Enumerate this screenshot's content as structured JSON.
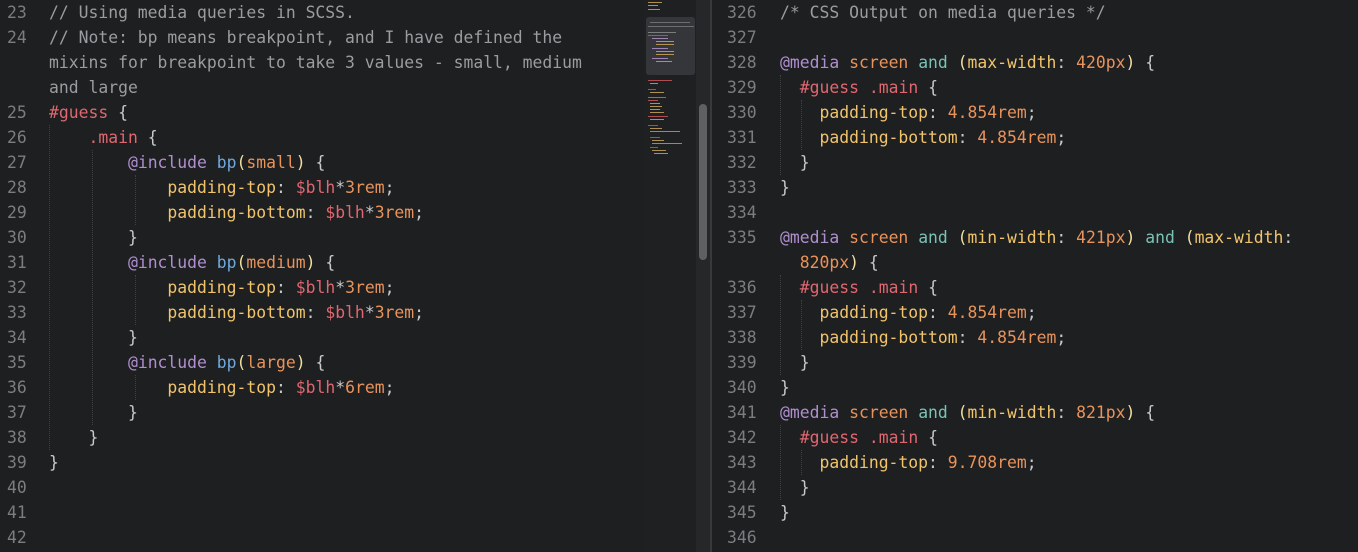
{
  "left_editor": {
    "language": "SCSS",
    "lines": [
      {
        "n": "23",
        "tokens": [
          [
            "c-comment",
            "// Using media queries in SCSS."
          ]
        ]
      },
      {
        "n": "24",
        "tokens": [
          [
            "c-comment",
            "// Note: bp means breakpoint, and I have defined the"
          ]
        ]
      },
      {
        "n": "",
        "tokens": [
          [
            "c-comment",
            "mixins for breakpoint to take 3 values - small, medium"
          ]
        ]
      },
      {
        "n": "",
        "tokens": [
          [
            "c-comment",
            "and large"
          ]
        ]
      },
      {
        "n": "25",
        "tokens": [
          [
            "c-sel-id",
            "#guess"
          ],
          [
            "c-punc",
            " "
          ],
          [
            "c-brace",
            "{"
          ]
        ]
      },
      {
        "n": "26",
        "tokens": [
          [
            "c-punc",
            "    "
          ],
          [
            "c-sel-class",
            ".main"
          ],
          [
            "c-punc",
            " "
          ],
          [
            "c-brace",
            "{"
          ]
        ]
      },
      {
        "n": "27",
        "tokens": [
          [
            "c-punc",
            "        "
          ],
          [
            "c-at",
            "@include"
          ],
          [
            "c-punc",
            " "
          ],
          [
            "c-func",
            "bp"
          ],
          [
            "c-paren",
            "("
          ],
          [
            "c-arg",
            "small"
          ],
          [
            "c-paren",
            ")"
          ],
          [
            "c-punc",
            " "
          ],
          [
            "c-brace",
            "{"
          ]
        ]
      },
      {
        "n": "28",
        "tokens": [
          [
            "c-punc",
            "            "
          ],
          [
            "c-prop",
            "padding-top"
          ],
          [
            "c-punc",
            ": "
          ],
          [
            "c-var",
            "$blh"
          ],
          [
            "c-punc",
            "*"
          ],
          [
            "c-num",
            "3rem"
          ],
          [
            "c-punc",
            ";"
          ]
        ]
      },
      {
        "n": "29",
        "tokens": [
          [
            "c-punc",
            "            "
          ],
          [
            "c-prop",
            "padding-bottom"
          ],
          [
            "c-punc",
            ": "
          ],
          [
            "c-var",
            "$blh"
          ],
          [
            "c-punc",
            "*"
          ],
          [
            "c-num",
            "3rem"
          ],
          [
            "c-punc",
            ";"
          ]
        ]
      },
      {
        "n": "30",
        "tokens": [
          [
            "c-punc",
            "        "
          ],
          [
            "c-brace",
            "}"
          ]
        ]
      },
      {
        "n": "31",
        "tokens": [
          [
            "c-punc",
            "        "
          ],
          [
            "c-at",
            "@include"
          ],
          [
            "c-punc",
            " "
          ],
          [
            "c-func",
            "bp"
          ],
          [
            "c-paren",
            "("
          ],
          [
            "c-arg",
            "medium"
          ],
          [
            "c-paren",
            ")"
          ],
          [
            "c-punc",
            " "
          ],
          [
            "c-brace",
            "{"
          ]
        ]
      },
      {
        "n": "32",
        "tokens": [
          [
            "c-punc",
            "            "
          ],
          [
            "c-prop",
            "padding-top"
          ],
          [
            "c-punc",
            ": "
          ],
          [
            "c-var",
            "$blh"
          ],
          [
            "c-punc",
            "*"
          ],
          [
            "c-num",
            "3rem"
          ],
          [
            "c-punc",
            ";"
          ]
        ]
      },
      {
        "n": "33",
        "tokens": [
          [
            "c-punc",
            "            "
          ],
          [
            "c-prop",
            "padding-bottom"
          ],
          [
            "c-punc",
            ": "
          ],
          [
            "c-var",
            "$blh"
          ],
          [
            "c-punc",
            "*"
          ],
          [
            "c-num",
            "3rem"
          ],
          [
            "c-punc",
            ";"
          ]
        ]
      },
      {
        "n": "34",
        "tokens": [
          [
            "c-punc",
            "        "
          ],
          [
            "c-brace",
            "}"
          ]
        ]
      },
      {
        "n": "35",
        "tokens": [
          [
            "c-punc",
            "        "
          ],
          [
            "c-at",
            "@include"
          ],
          [
            "c-punc",
            " "
          ],
          [
            "c-func",
            "bp"
          ],
          [
            "c-paren",
            "("
          ],
          [
            "c-arg",
            "large"
          ],
          [
            "c-paren",
            ")"
          ],
          [
            "c-punc",
            " "
          ],
          [
            "c-brace",
            "{"
          ]
        ]
      },
      {
        "n": "36",
        "tokens": [
          [
            "c-punc",
            "            "
          ],
          [
            "c-prop",
            "padding-top"
          ],
          [
            "c-punc",
            ": "
          ],
          [
            "c-var",
            "$blh"
          ],
          [
            "c-punc",
            "*"
          ],
          [
            "c-num",
            "6rem"
          ],
          [
            "c-punc",
            ";"
          ]
        ]
      },
      {
        "n": "37",
        "tokens": [
          [
            "c-punc",
            "        "
          ],
          [
            "c-brace",
            "}"
          ]
        ]
      },
      {
        "n": "38",
        "tokens": [
          [
            "c-punc",
            "    "
          ],
          [
            "c-brace",
            "}"
          ]
        ]
      },
      {
        "n": "39",
        "tokens": [
          [
            "c-brace",
            "}"
          ]
        ]
      },
      {
        "n": "40",
        "tokens": []
      },
      {
        "n": "41",
        "tokens": []
      },
      {
        "n": "42",
        "tokens": []
      }
    ]
  },
  "right_editor": {
    "language": "CSS",
    "lines": [
      {
        "n": "326",
        "tokens": [
          [
            "c-comment",
            "/* CSS Output on media queries */"
          ]
        ]
      },
      {
        "n": "327",
        "tokens": []
      },
      {
        "n": "328",
        "tokens": [
          [
            "c-at",
            "@media"
          ],
          [
            "c-punc",
            " "
          ],
          [
            "c-kw",
            "screen"
          ],
          [
            "c-punc",
            " "
          ],
          [
            "c-and",
            "and"
          ],
          [
            "c-punc",
            " "
          ],
          [
            "c-paren",
            "("
          ],
          [
            "c-prop",
            "max-width"
          ],
          [
            "c-punc",
            ": "
          ],
          [
            "c-num",
            "420px"
          ],
          [
            "c-paren",
            ")"
          ],
          [
            "c-punc",
            " "
          ],
          [
            "c-brace",
            "{"
          ]
        ]
      },
      {
        "n": "329",
        "tokens": [
          [
            "c-punc",
            "  "
          ],
          [
            "c-sel-id",
            "#guess"
          ],
          [
            "c-punc",
            " "
          ],
          [
            "c-sel-class",
            ".main"
          ],
          [
            "c-punc",
            " "
          ],
          [
            "c-brace",
            "{"
          ]
        ]
      },
      {
        "n": "330",
        "tokens": [
          [
            "c-punc",
            "    "
          ],
          [
            "c-prop",
            "padding-top"
          ],
          [
            "c-punc",
            ": "
          ],
          [
            "c-num",
            "4.854rem"
          ],
          [
            "c-punc",
            ";"
          ]
        ]
      },
      {
        "n": "331",
        "tokens": [
          [
            "c-punc",
            "    "
          ],
          [
            "c-prop",
            "padding-bottom"
          ],
          [
            "c-punc",
            ": "
          ],
          [
            "c-num",
            "4.854rem"
          ],
          [
            "c-punc",
            ";"
          ]
        ]
      },
      {
        "n": "332",
        "tokens": [
          [
            "c-punc",
            "  "
          ],
          [
            "c-brace",
            "}"
          ]
        ]
      },
      {
        "n": "333",
        "tokens": [
          [
            "c-brace",
            "}"
          ]
        ]
      },
      {
        "n": "334",
        "tokens": []
      },
      {
        "n": "335",
        "tokens": [
          [
            "c-at",
            "@media"
          ],
          [
            "c-punc",
            " "
          ],
          [
            "c-kw",
            "screen"
          ],
          [
            "c-punc",
            " "
          ],
          [
            "c-and",
            "and"
          ],
          [
            "c-punc",
            " "
          ],
          [
            "c-paren",
            "("
          ],
          [
            "c-prop",
            "min-width"
          ],
          [
            "c-punc",
            ": "
          ],
          [
            "c-num",
            "421px"
          ],
          [
            "c-paren",
            ")"
          ],
          [
            "c-punc",
            " "
          ],
          [
            "c-and",
            "and"
          ],
          [
            "c-punc",
            " "
          ],
          [
            "c-paren",
            "("
          ],
          [
            "c-prop",
            "max-width"
          ],
          [
            "c-punc",
            ":"
          ]
        ]
      },
      {
        "n": "",
        "tokens": [
          [
            "c-punc",
            "  "
          ],
          [
            "c-num",
            "820px"
          ],
          [
            "c-paren",
            ")"
          ],
          [
            "c-punc",
            " "
          ],
          [
            "c-brace",
            "{"
          ]
        ]
      },
      {
        "n": "336",
        "tokens": [
          [
            "c-punc",
            "  "
          ],
          [
            "c-sel-id",
            "#guess"
          ],
          [
            "c-punc",
            " "
          ],
          [
            "c-sel-class",
            ".main"
          ],
          [
            "c-punc",
            " "
          ],
          [
            "c-brace",
            "{"
          ]
        ]
      },
      {
        "n": "337",
        "tokens": [
          [
            "c-punc",
            "    "
          ],
          [
            "c-prop",
            "padding-top"
          ],
          [
            "c-punc",
            ": "
          ],
          [
            "c-num",
            "4.854rem"
          ],
          [
            "c-punc",
            ";"
          ]
        ]
      },
      {
        "n": "338",
        "tokens": [
          [
            "c-punc",
            "    "
          ],
          [
            "c-prop",
            "padding-bottom"
          ],
          [
            "c-punc",
            ": "
          ],
          [
            "c-num",
            "4.854rem"
          ],
          [
            "c-punc",
            ";"
          ]
        ]
      },
      {
        "n": "339",
        "tokens": [
          [
            "c-punc",
            "  "
          ],
          [
            "c-brace",
            "}"
          ]
        ]
      },
      {
        "n": "340",
        "tokens": [
          [
            "c-brace",
            "}"
          ]
        ]
      },
      {
        "n": "341",
        "tokens": [
          [
            "c-at",
            "@media"
          ],
          [
            "c-punc",
            " "
          ],
          [
            "c-kw",
            "screen"
          ],
          [
            "c-punc",
            " "
          ],
          [
            "c-and",
            "and"
          ],
          [
            "c-punc",
            " "
          ],
          [
            "c-paren",
            "("
          ],
          [
            "c-prop",
            "min-width"
          ],
          [
            "c-punc",
            ": "
          ],
          [
            "c-num",
            "821px"
          ],
          [
            "c-paren",
            ")"
          ],
          [
            "c-punc",
            " "
          ],
          [
            "c-brace",
            "{"
          ]
        ]
      },
      {
        "n": "342",
        "tokens": [
          [
            "c-punc",
            "  "
          ],
          [
            "c-sel-id",
            "#guess"
          ],
          [
            "c-punc",
            " "
          ],
          [
            "c-sel-class",
            ".main"
          ],
          [
            "c-punc",
            " "
          ],
          [
            "c-brace",
            "{"
          ]
        ]
      },
      {
        "n": "343",
        "tokens": [
          [
            "c-punc",
            "    "
          ],
          [
            "c-prop",
            "padding-top"
          ],
          [
            "c-punc",
            ": "
          ],
          [
            "c-num",
            "9.708rem"
          ],
          [
            "c-punc",
            ";"
          ]
        ]
      },
      {
        "n": "344",
        "tokens": [
          [
            "c-punc",
            "  "
          ],
          [
            "c-brace",
            "}"
          ]
        ]
      },
      {
        "n": "345",
        "tokens": [
          [
            "c-brace",
            "}"
          ]
        ]
      },
      {
        "n": "346",
        "tokens": []
      }
    ]
  },
  "icons": {
    "minimap": "minimap",
    "scrollbar": "vertical-scrollbar"
  }
}
